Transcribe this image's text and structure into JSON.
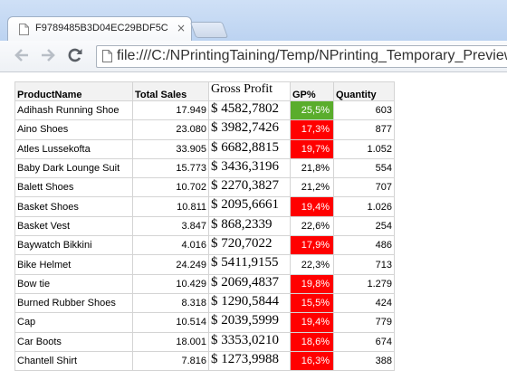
{
  "browser": {
    "tab_title": "F9789485B3D04EC29BDF5C",
    "tab_close": "×",
    "address": "file:///C:/NPrintingTaining/Temp/NPrinting_Temporary_Preview",
    "back_icon": "back-arrow-icon",
    "forward_icon": "forward-arrow-icon",
    "reload_icon": "reload-icon"
  },
  "table": {
    "headers": {
      "product": "ProductName",
      "sales": "Total Sales",
      "gross_profit": "Gross Profit",
      "gp_pct": "GP%",
      "quantity": "Quantity"
    },
    "colors": {
      "green": "#5aad2c",
      "red": "#ff0000"
    },
    "rows": [
      {
        "product": "Adihash Running Shoe",
        "sales": "17.949",
        "gross_profit": "$ 4582,7802",
        "gp_pct": "25,5%",
        "pct_color": "green",
        "quantity": "603"
      },
      {
        "product": "Aino Shoes",
        "sales": "23.080",
        "gross_profit": "$ 3982,7426",
        "gp_pct": "17,3%",
        "pct_color": "red",
        "quantity": "877"
      },
      {
        "product": "Atles Lussekofta",
        "sales": "33.905",
        "gross_profit": "$ 6682,8815",
        "gp_pct": "19,7%",
        "pct_color": "red",
        "quantity": "1.052"
      },
      {
        "product": "Baby Dark Lounge Suit",
        "sales": "15.773",
        "gross_profit": "$ 3436,3196",
        "gp_pct": "21,8%",
        "pct_color": "none",
        "quantity": "554"
      },
      {
        "product": "Balett Shoes",
        "sales": "10.702",
        "gross_profit": "$ 2270,3827",
        "gp_pct": "21,2%",
        "pct_color": "none",
        "quantity": "707"
      },
      {
        "product": "Basket Shoes",
        "sales": "10.811",
        "gross_profit": "$ 2095,6661",
        "gp_pct": "19,4%",
        "pct_color": "red",
        "quantity": "1.026"
      },
      {
        "product": "Basket Vest",
        "sales": "3.847",
        "gross_profit": "$ 868,2339",
        "gp_pct": "22,6%",
        "pct_color": "none",
        "quantity": "254"
      },
      {
        "product": "Baywatch Bikkini",
        "sales": "4.016",
        "gross_profit": "$ 720,7022",
        "gp_pct": "17,9%",
        "pct_color": "red",
        "quantity": "486"
      },
      {
        "product": "Bike Helmet",
        "sales": "24.249",
        "gross_profit": "$ 5411,9155",
        "gp_pct": "22,3%",
        "pct_color": "none",
        "quantity": "713"
      },
      {
        "product": "Bow tie",
        "sales": "10.429",
        "gross_profit": "$ 2069,4837",
        "gp_pct": "19,8%",
        "pct_color": "red",
        "quantity": "1.279"
      },
      {
        "product": "Burned Rubber Shoes",
        "sales": "8.318",
        "gross_profit": "$ 1290,5844",
        "gp_pct": "15,5%",
        "pct_color": "red",
        "quantity": "424"
      },
      {
        "product": "Cap",
        "sales": "10.514",
        "gross_profit": "$ 2039,5999",
        "gp_pct": "19,4%",
        "pct_color": "red",
        "quantity": "779"
      },
      {
        "product": "Car Boots",
        "sales": "18.001",
        "gross_profit": "$ 3353,0210",
        "gp_pct": "18,6%",
        "pct_color": "red",
        "quantity": "674"
      },
      {
        "product": "Chantell Shirt",
        "sales": "7.816",
        "gross_profit": "$ 1273,9988",
        "gp_pct": "16,3%",
        "pct_color": "red",
        "quantity": "388"
      }
    ]
  }
}
